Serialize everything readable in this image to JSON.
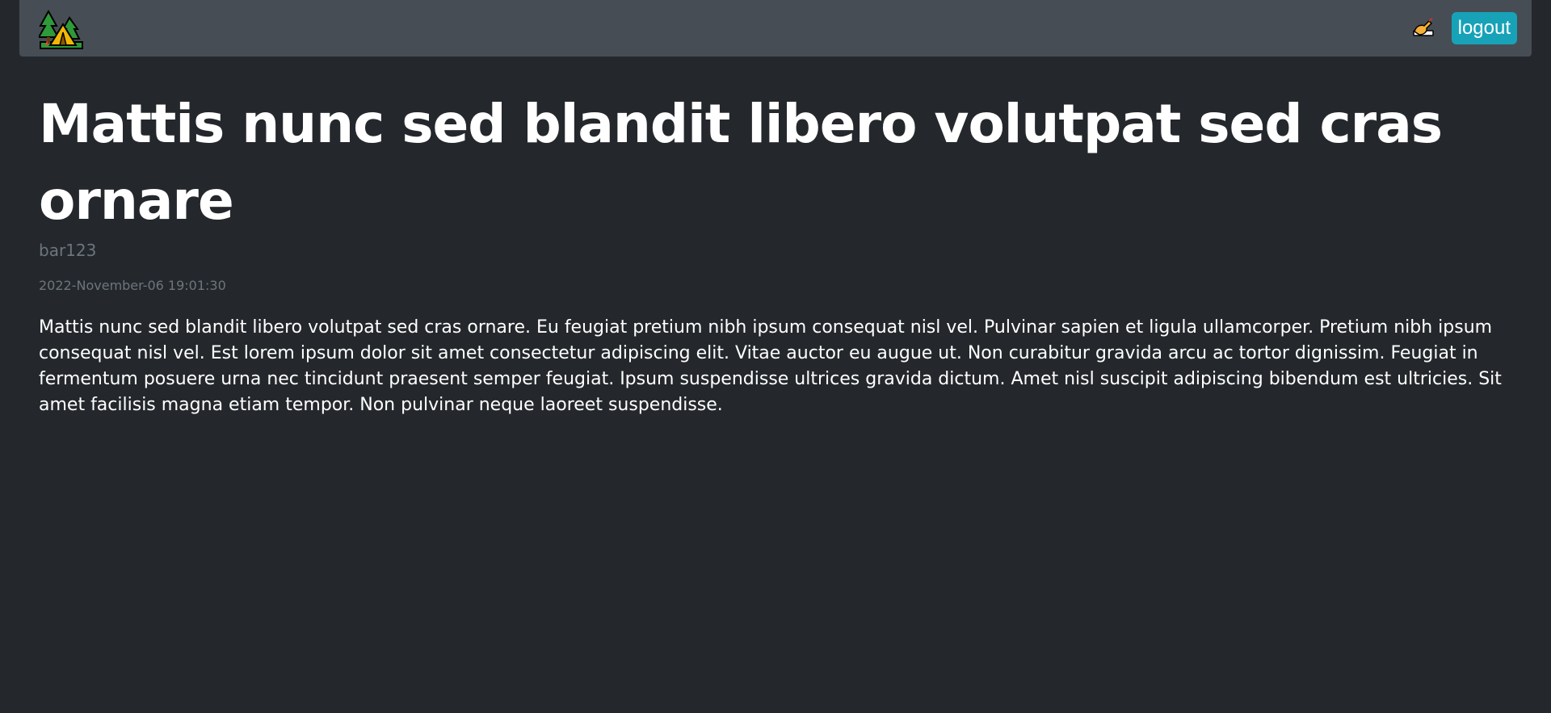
{
  "header": {
    "logo_icon": "camping-tent-trees-icon",
    "write_icon": "writing-hand-icon",
    "logout_label": "logout"
  },
  "post": {
    "title": "Mattis nunc sed blandit libero volutpat sed cras ornare",
    "author": "bar123",
    "date": "2022-November-06 19:01:30",
    "body": "Mattis nunc sed blandit libero volutpat sed cras ornare. Eu feugiat pretium nibh ipsum consequat nisl vel. Pulvinar sapien et ligula ullamcorper. Pretium nibh ipsum consequat nisl vel. Est lorem ipsum dolor sit amet consectetur adipiscing elit. Vitae auctor eu augue ut. Non curabitur gravida arcu ac tortor dignissim. Feugiat in fermentum posuere urna nec tincidunt praesent semper feugiat. Ipsum suspendisse ultrices gravida dictum. Amet nisl suscipit adipiscing bibendum est ultricies. Sit amet facilisis magna etiam tempor. Non pulvinar neque laoreet suspendisse."
  },
  "colors": {
    "background": "#24282c",
    "navbar": "#474d55",
    "button": "#17a2b8",
    "muted_text": "#6c757d"
  }
}
